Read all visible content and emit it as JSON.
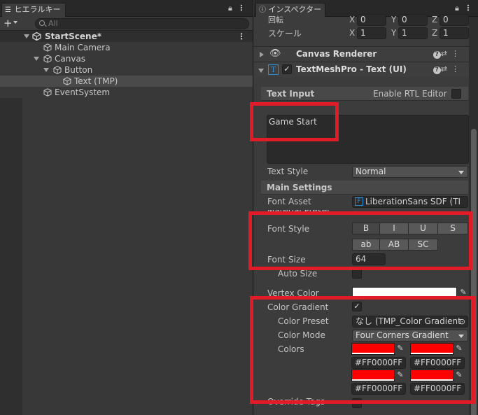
{
  "hierarchy": {
    "tab_label": "ヒエラルキー",
    "search_placeholder": "All",
    "scene": "StartScene*",
    "items": [
      {
        "label": "Main Camera"
      },
      {
        "label": "Canvas"
      },
      {
        "label": "Button"
      },
      {
        "label": "Text (TMP)"
      },
      {
        "label": "EventSystem"
      }
    ]
  },
  "inspector": {
    "tab_label": "インスペクター",
    "transform": {
      "rotation_label": "回転",
      "rotation": {
        "x": "0",
        "y": "0",
        "z": "0"
      },
      "scale_label": "スケール",
      "scale": {
        "x": "1",
        "y": "1",
        "z": "1"
      },
      "axes": {
        "x": "X",
        "y": "Y",
        "z": "Z"
      }
    },
    "canvas_renderer": {
      "title": "Canvas Renderer"
    },
    "tmp": {
      "title": "TextMeshPro - Text (UI)",
      "text_input_label": "Text Input",
      "rtl_label": "Enable RTL Editor",
      "text_value": "Game Start",
      "text_style_label": "Text Style",
      "text_style_value": "Normal",
      "main_settings_label": "Main Settings",
      "font_asset_label": "Font Asset",
      "font_asset_value": "LiberationSans SDF (TI",
      "material_preset_label": "Material Preset",
      "font_style_label": "Font Style",
      "font_style_buttons": [
        "B",
        "I",
        "U",
        "S",
        "ab",
        "AB",
        "SC"
      ],
      "font_size_label": "Font Size",
      "font_size_value": "64",
      "auto_size_label": "Auto Size",
      "vertex_color_label": "Vertex Color",
      "color_gradient_label": "Color Gradient",
      "color_preset_label": "Color Preset",
      "color_preset_value": "なし (TMP_Color Gradient",
      "color_mode_label": "Color Mode",
      "color_mode_value": "Four Corners Gradient",
      "colors_label": "Colors",
      "colors_hex": [
        "#FF0000FF",
        "#FF0000FF",
        "#FF0000FF",
        "#FF0000FF"
      ],
      "override_tags_label": "Override Tags"
    }
  },
  "colors": {
    "highlight": "#E21B28",
    "gradient_red": "#FF0000",
    "vertex_white": "#FFFFFF",
    "tmp_icon": "#2B8FD6"
  }
}
